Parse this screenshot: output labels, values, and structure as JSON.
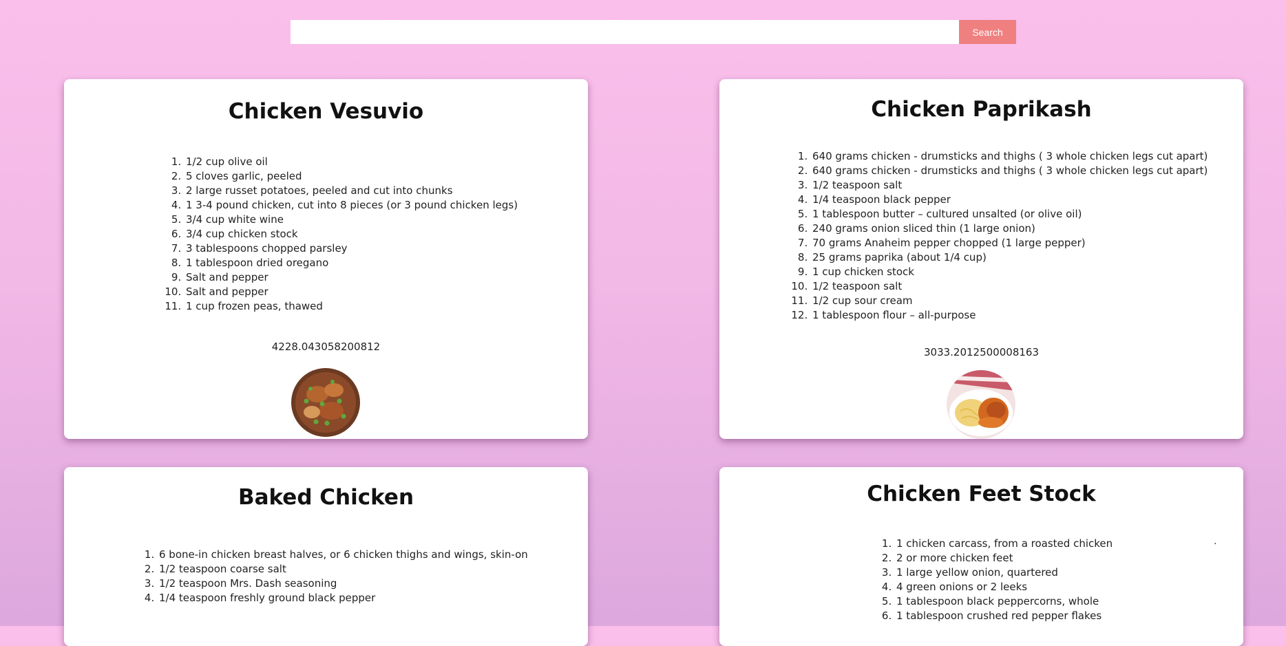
{
  "search": {
    "placeholder": "",
    "value": "",
    "button_label": "Search"
  },
  "recipes": [
    {
      "title": "Chicken Vesuvio",
      "ingredients": [
        "1/2 cup olive oil",
        "5 cloves garlic, peeled",
        "2 large russet potatoes, peeled and cut into chunks",
        "1 3-4 pound chicken, cut into 8 pieces (or 3 pound chicken legs)",
        "3/4 cup white wine",
        "3/4 cup chicken stock",
        "3 tablespoons chopped parsley",
        "1 tablespoon dried oregano",
        "Salt and pepper",
        "Salt and pepper",
        "1 cup frozen peas, thawed"
      ],
      "calories": "4228.043058200812"
    },
    {
      "title": "Chicken Paprikash",
      "ingredients": [
        "640 grams chicken - drumsticks and thighs ( 3 whole chicken legs cut apart)",
        "640 grams chicken - drumsticks and thighs ( 3 whole chicken legs cut apart)",
        "1/2 teaspoon salt",
        "1/4 teaspoon black pepper",
        "1 tablespoon butter – cultured unsalted (or olive oil)",
        "240 grams onion sliced thin (1 large onion)",
        "70 grams Anaheim pepper chopped (1 large pepper)",
        "25 grams paprika (about 1/4 cup)",
        "1 cup chicken stock",
        "1/2 teaspoon salt",
        "1/2 cup sour cream",
        "1 tablespoon flour – all-purpose"
      ],
      "calories": "3033.2012500008163"
    },
    {
      "title": "Baked Chicken",
      "ingredients": [
        "6 bone-in chicken breast halves, or 6 chicken thighs and wings, skin-on",
        "1/2 teaspoon coarse salt",
        "1/2 teaspoon Mrs. Dash seasoning",
        "1/4 teaspoon freshly ground black pepper"
      ]
    },
    {
      "title": "Chicken Feet Stock",
      "ingredients": [
        "1 chicken carcass, from a roasted chicken",
        "2 or more chicken feet",
        "1 large yellow onion, quartered",
        "4 green onions or 2 leeks",
        "1 tablespoon black peppercorns, whole",
        "1 tablespoon crushed red pepper flakes"
      ],
      "stray_mark": "."
    }
  ],
  "colors": {
    "background_top": "#fbbfeb",
    "background_bottom": "#dca8dd",
    "search_button": "#f08080",
    "card": "#ffffff"
  },
  "icons": {
    "recipe_images": [
      "chicken-vesuvio-photo",
      "chicken-paprikash-photo"
    ]
  }
}
